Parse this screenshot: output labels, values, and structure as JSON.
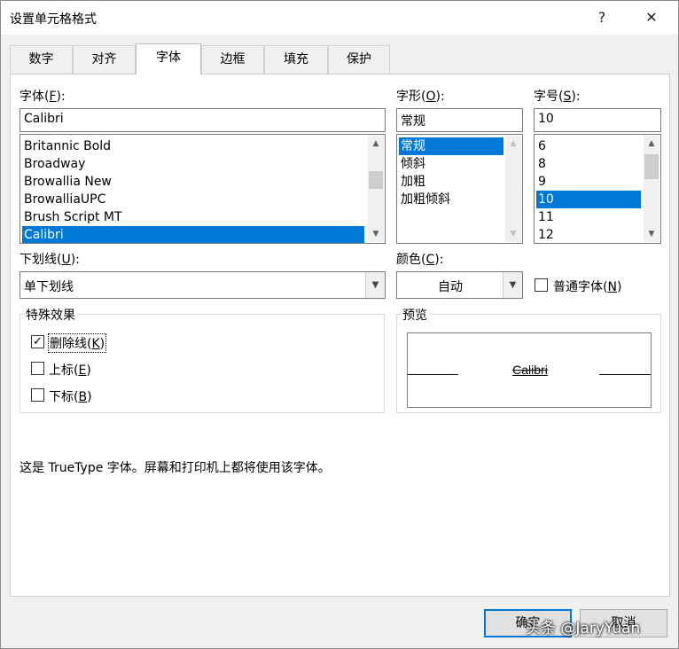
{
  "window": {
    "title": "设置单元格格式",
    "help": "?",
    "close": "✕"
  },
  "tabs": [
    {
      "label": "数字"
    },
    {
      "label": "对齐"
    },
    {
      "label": "字体"
    },
    {
      "label": "边框"
    },
    {
      "label": "填充"
    },
    {
      "label": "保护"
    }
  ],
  "active_tab": "字体",
  "font": {
    "label": "字体(",
    "key": "F",
    "label_end": "):",
    "value": "Calibri",
    "items": [
      "Britannic Bold",
      "Broadway",
      "Browallia New",
      "BrowalliaUPC",
      "Brush Script MT",
      "Calibri"
    ],
    "selected": "Calibri"
  },
  "style": {
    "label": "字形(",
    "key": "O",
    "label_end": "):",
    "value": "常规",
    "items": [
      "常规",
      "倾斜",
      "加粗",
      "加粗倾斜"
    ],
    "selected": "常规"
  },
  "size": {
    "label": "字号(",
    "key": "S",
    "label_end": "):",
    "value": "10",
    "items": [
      "6",
      "8",
      "9",
      "10",
      "11",
      "12"
    ],
    "selected": "10"
  },
  "underline": {
    "label": "下划线(",
    "key": "U",
    "label_end": "):",
    "value": "单下划线"
  },
  "color": {
    "label": "颜色(",
    "key": "C",
    "label_end": "):",
    "value": "自动"
  },
  "normal_font": {
    "label": "普通字体(",
    "key": "N",
    "label_end": ")",
    "checked": false
  },
  "effects": {
    "title": "特殊效果",
    "items": [
      {
        "label": "删除线(",
        "key": "K",
        "label_end": ")",
        "checked": true
      },
      {
        "label": "上标(",
        "key": "E",
        "label_end": ")",
        "checked": false
      },
      {
        "label": "下标(",
        "key": "B",
        "label_end": ")",
        "checked": false
      }
    ]
  },
  "preview": {
    "title": "预览",
    "sample": "Calibri"
  },
  "info": "这是 TrueType 字体。屏幕和打印机上都将使用该字体。",
  "buttons": {
    "ok": "确定",
    "cancel": "取消"
  },
  "watermark": "头条 @JaryYuan",
  "colors": {
    "selection": "#0078d7",
    "default_button_border": "#0078d7"
  }
}
